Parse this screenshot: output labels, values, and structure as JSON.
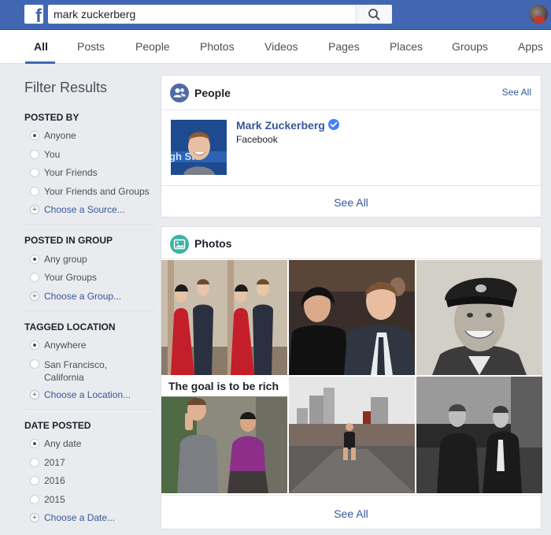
{
  "header": {
    "search_value": "mark zuckerberg"
  },
  "tabs": [
    {
      "label": "All",
      "active": true
    },
    {
      "label": "Posts"
    },
    {
      "label": "People"
    },
    {
      "label": "Photos"
    },
    {
      "label": "Videos"
    },
    {
      "label": "Pages"
    },
    {
      "label": "Places"
    },
    {
      "label": "Groups"
    },
    {
      "label": "Apps"
    }
  ],
  "sidebar": {
    "title": "Filter Results",
    "sections": [
      {
        "heading": "POSTED BY",
        "options": [
          "Anyone",
          "You",
          "Your Friends",
          "Your Friends and Groups"
        ],
        "selected": "Anyone",
        "choose": "Choose a Source..."
      },
      {
        "heading": "POSTED IN GROUP",
        "options": [
          "Any group",
          "Your Groups"
        ],
        "selected": "Any group",
        "choose": "Choose a Group..."
      },
      {
        "heading": "TAGGED LOCATION",
        "options": [
          "Anywhere",
          "San Francisco, California"
        ],
        "selected": "Anywhere",
        "choose": "Choose a Location..."
      },
      {
        "heading": "DATE POSTED",
        "options": [
          "Any date",
          "2017",
          "2016",
          "2015"
        ],
        "selected": "Any date",
        "choose": "Choose a Date..."
      }
    ]
  },
  "people": {
    "title": "People",
    "see_all_top": "See All",
    "result_name": "Mark Zuckerberg",
    "result_sub": "Facebook",
    "see_all_bottom": "See All"
  },
  "photos": {
    "title": "Photos",
    "caption": "The goal is to be rich",
    "see_all_bottom": "See All"
  },
  "colors": {
    "brand": "#4267b2",
    "link": "#365899",
    "verified": "#4080ff",
    "people_icon": "#4e6aa3",
    "photos_icon": "#3bb4a5"
  },
  "icons": {
    "logo": "facebook-f-icon",
    "search": "magnifier-icon",
    "people": "people-icon",
    "photos": "image-icon",
    "verified": "verified-badge-icon"
  }
}
